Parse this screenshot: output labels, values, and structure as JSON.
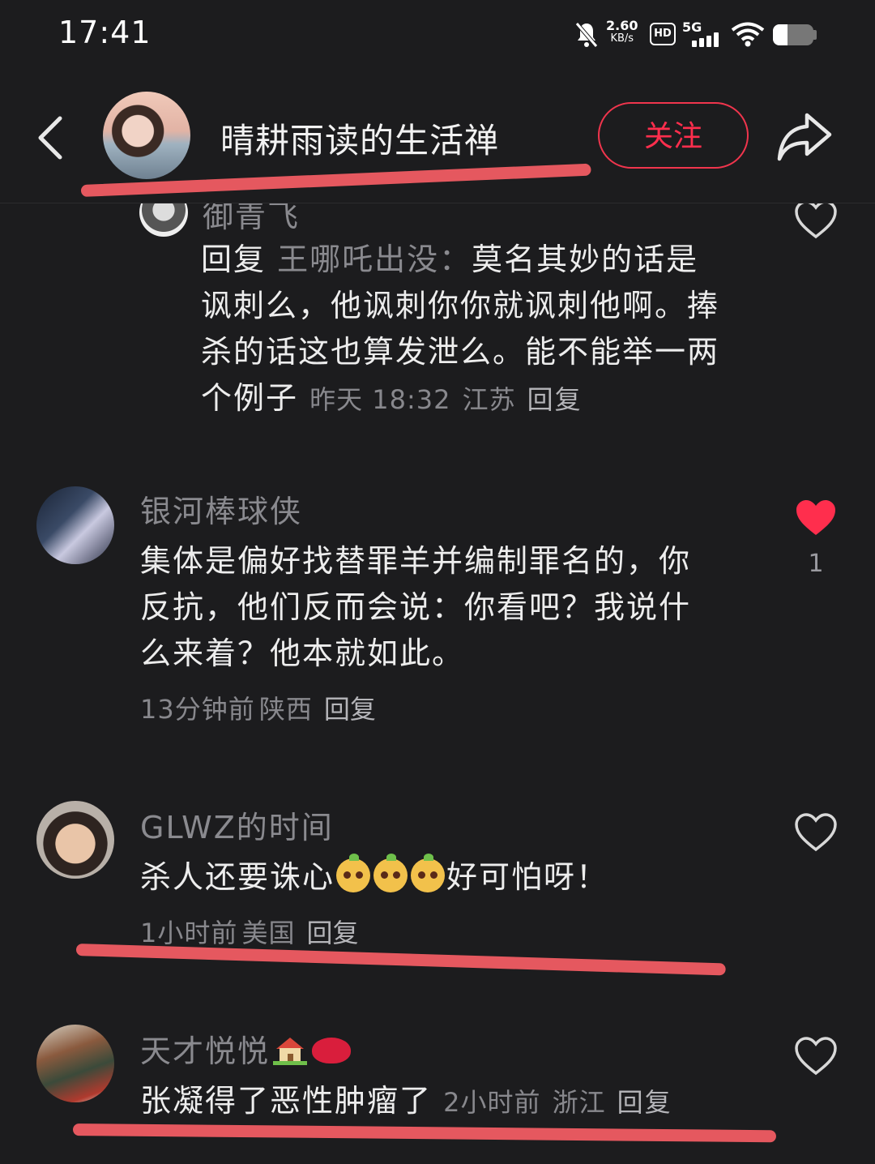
{
  "status_bar": {
    "time": "17:41",
    "speed_value": "2.60",
    "speed_unit": "KB/s",
    "hd": "HD",
    "network": "5G",
    "icons": [
      "mute-bell-icon",
      "signal-bars-icon",
      "wifi-icon",
      "battery-icon"
    ],
    "battery_level": 0.35
  },
  "header": {
    "author_name": "晴耕雨读的生活禅",
    "follow_label": "关注",
    "icons": [
      "back-chevron-icon",
      "share-arrow-icon"
    ]
  },
  "comments": [
    {
      "username": "御青飞",
      "reply_prefix": "回复",
      "reply_target": "王哪吒出没：",
      "text_lines": [
        "莫名其妙的话是",
        "讽刺么，他讽刺你你就讽刺他啊。捧",
        "杀的话这也算发泄么。能不能举一两",
        "个例子"
      ],
      "time": "昨天 18:32",
      "location": "江苏",
      "reply_label": "回复",
      "liked": false
    },
    {
      "username": "银河棒球侠",
      "text_lines": [
        "集体是偏好找替罪羊并编制罪名的，你",
        "反抗，他们反而会说：你看吧？我说什",
        "么来着？他本就如此。"
      ],
      "time": "13分钟前",
      "location": "陕西",
      "reply_label": "回复",
      "liked": true,
      "likes": "1"
    },
    {
      "username": "GLWZ的时间",
      "text_before": "杀人还要诛心",
      "text_after": "好可怕呀！",
      "emoji_count": 3,
      "time": "1小时前",
      "location": "美国",
      "reply_label": "回复",
      "liked": false
    },
    {
      "username": "天才悦悦",
      "username_emojis": [
        "house-emoji",
        "lips-emoji"
      ],
      "text": "张凝得了恶性肿瘤了",
      "time": "2小时前",
      "location": "浙江",
      "reply_label": "回复",
      "liked": false
    }
  ],
  "colors": {
    "background": "#1c1c1e",
    "accent_red": "#ff2e4d",
    "annotation_stroke": "#e5585f",
    "like_red": "#ff2e4d"
  }
}
